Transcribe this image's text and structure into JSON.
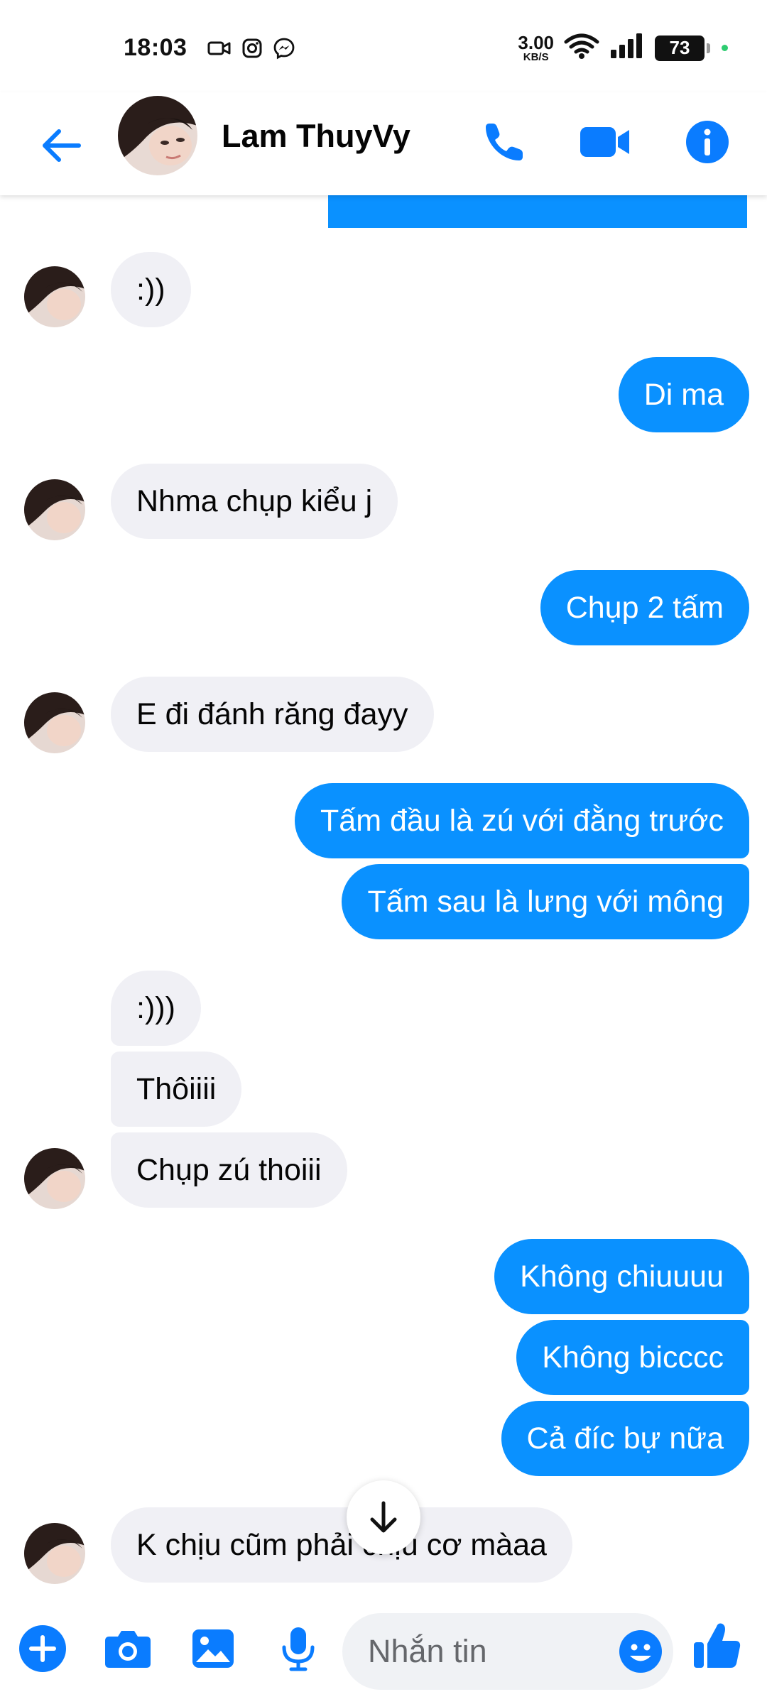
{
  "status_bar": {
    "time": "18:03",
    "net_speed_value": "3.00",
    "net_speed_unit": "KB/S",
    "battery_level": "73"
  },
  "header": {
    "contact_name": "Lam ThuyVy"
  },
  "messages": [
    {
      "sender": "other",
      "text": ":))"
    },
    {
      "sender": "me",
      "text": "Di ma"
    },
    {
      "sender": "other",
      "text": "Nhma chụp kiểu j"
    },
    {
      "sender": "me",
      "text": "Chụp 2 tấm"
    },
    {
      "sender": "other",
      "text": "E đi đánh răng đayy"
    },
    {
      "sender": "me",
      "text": "Tấm đầu là zú với đằng trước"
    },
    {
      "sender": "me",
      "text": "Tấm sau là lưng với mông"
    },
    {
      "sender": "other",
      "text": ":)))"
    },
    {
      "sender": "other",
      "text": "Thôiiii"
    },
    {
      "sender": "other",
      "text": "Chụp zú thoiii"
    },
    {
      "sender": "me",
      "text": "Không chiuuuu"
    },
    {
      "sender": "me",
      "text": "Không bicccc"
    },
    {
      "sender": "me",
      "text": "Cả đíc bự nữa"
    },
    {
      "sender": "other",
      "text": "K chịu cũm phải chịu cơ màaa"
    }
  ],
  "composer": {
    "placeholder": "Nhắn tin"
  },
  "colors": {
    "accent": "#0a91ff",
    "incoming_bubble": "#f0f0f5",
    "icon_blue": "#0a7cff"
  },
  "icons": {
    "back": "arrow-left-icon",
    "call": "phone-icon",
    "video": "video-camera-icon",
    "info": "info-icon",
    "scroll_down": "arrow-down-icon",
    "add": "plus-icon",
    "camera": "camera-icon",
    "gallery": "image-icon",
    "voice": "microphone-icon",
    "emoji": "emoji-icon",
    "like": "thumbs-up-icon"
  }
}
